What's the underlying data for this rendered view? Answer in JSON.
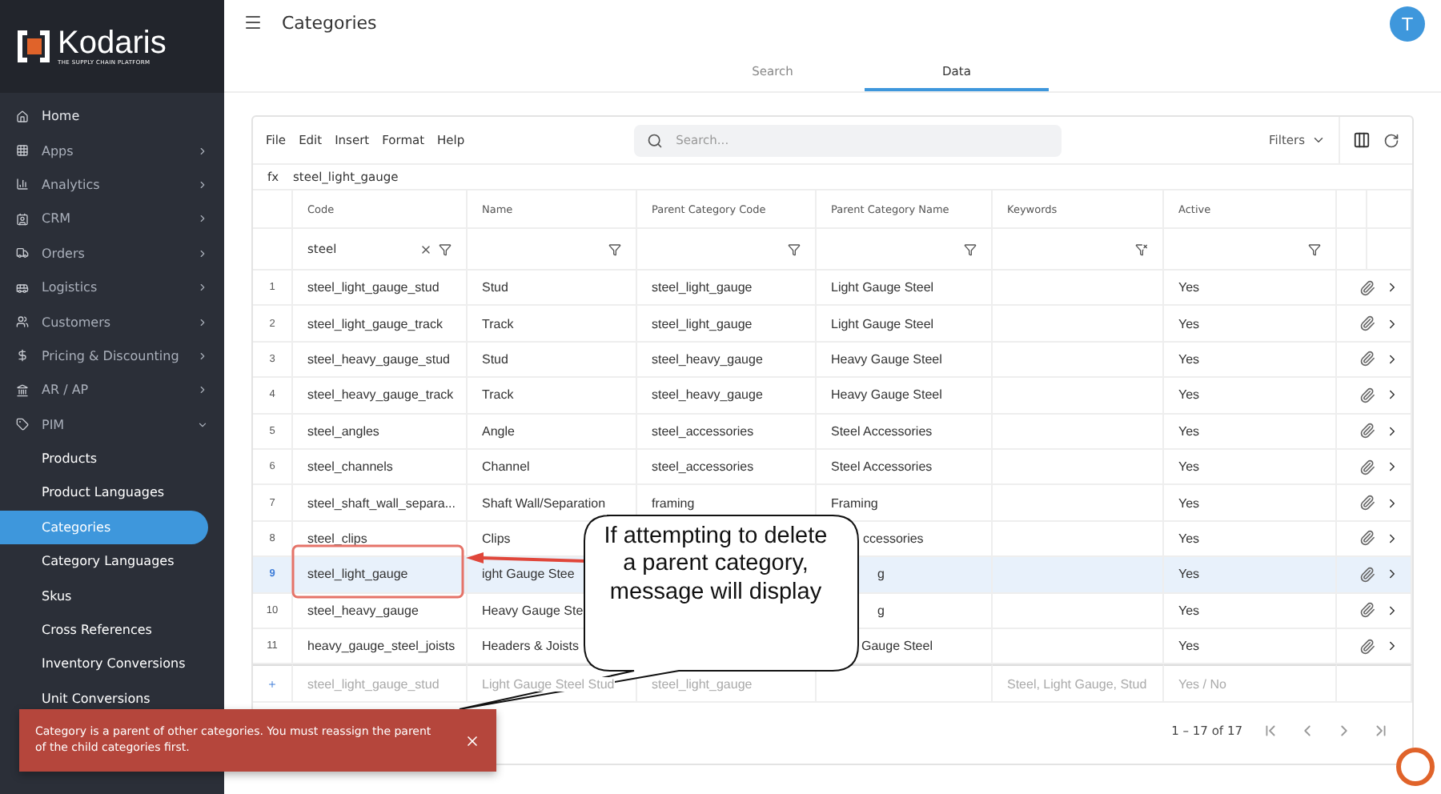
{
  "sidebar": {
    "logo": {
      "name": "Kodaris",
      "tagline": "THE SUPPLY CHAIN PLATFORM"
    },
    "items": [
      {
        "label": "Home",
        "kind": "link"
      },
      {
        "label": "Apps",
        "kind": "group",
        "expanded": false
      },
      {
        "label": "Analytics",
        "kind": "group",
        "expanded": false
      },
      {
        "label": "CRM",
        "kind": "group",
        "expanded": false
      },
      {
        "label": "Orders",
        "kind": "group",
        "expanded": false
      },
      {
        "label": "Logistics",
        "kind": "group",
        "expanded": false
      },
      {
        "label": "Customers",
        "kind": "group",
        "expanded": false
      },
      {
        "label": "Pricing & Discounting",
        "kind": "group",
        "expanded": false
      },
      {
        "label": "AR / AP",
        "kind": "group",
        "expanded": false
      },
      {
        "label": "PIM",
        "kind": "group",
        "expanded": true,
        "children": [
          {
            "label": "Products",
            "selected": false
          },
          {
            "label": "Product Languages",
            "selected": false
          },
          {
            "label": "Categories",
            "selected": true
          },
          {
            "label": "Category Languages",
            "selected": false
          },
          {
            "label": "Skus",
            "selected": false
          },
          {
            "label": "Cross References",
            "selected": false
          },
          {
            "label": "Inventory Conversions",
            "selected": false
          },
          {
            "label": "Unit Conversions",
            "selected": false
          }
        ]
      }
    ]
  },
  "header": {
    "title": "Categories",
    "avatar": "T"
  },
  "tabs": [
    {
      "label": "Search",
      "selected": false
    },
    {
      "label": "Data",
      "selected": true
    }
  ],
  "toolbar": {
    "menu": [
      "File",
      "Edit",
      "Insert",
      "Format",
      "Help"
    ],
    "search": {
      "placeholder": "Search..."
    },
    "filters": "Filters"
  },
  "formula_bar": {
    "label": "fx",
    "value": "steel_light_gauge"
  },
  "table": {
    "columns": [
      {
        "label": "Code",
        "filter": "steel",
        "filter_cleared": false
      },
      {
        "label": "Name",
        "filter_cleared": false
      },
      {
        "label": "Parent Category Code",
        "filter_cleared": false
      },
      {
        "label": "Parent Category Name",
        "filter_cleared": false
      },
      {
        "label": "Keywords",
        "filter_cleared": true
      },
      {
        "label": "Active",
        "filter_cleared": false
      }
    ],
    "rows": [
      {
        "num": "1",
        "code": "steel_light_gauge_stud",
        "name": "Stud",
        "parent_code": "steel_light_gauge",
        "parent_name": "Light Gauge Steel",
        "active": "Yes",
        "selected": false
      },
      {
        "num": "2",
        "code": "steel_light_gauge_track",
        "name": "Track",
        "parent_code": "steel_light_gauge",
        "parent_name": "Light Gauge Steel",
        "active": "Yes",
        "selected": false
      },
      {
        "num": "3",
        "code": "steel_heavy_gauge_stud",
        "name": "Stud",
        "parent_code": "steel_heavy_gauge",
        "parent_name": "Heavy Gauge Steel",
        "active": "Yes",
        "selected": false
      },
      {
        "num": "4",
        "code": "steel_heavy_gauge_track",
        "name": "Track",
        "parent_code": "steel_heavy_gauge",
        "parent_name": "Heavy Gauge Steel",
        "active": "Yes",
        "selected": false
      },
      {
        "num": "5",
        "code": "steel_angles",
        "name": "Angle",
        "parent_code": "steel_accessories",
        "parent_name": "Steel Accessories",
        "active": "Yes",
        "selected": false
      },
      {
        "num": "6",
        "code": "steel_channels",
        "name": "Channel",
        "parent_code": "steel_accessories",
        "parent_name": "Steel Accessories",
        "active": "Yes",
        "selected": false
      },
      {
        "num": "7",
        "code": "steel_shaft_wall_separa...",
        "name": "Shaft Wall/Separation",
        "parent_code": "framing",
        "parent_name": "Framing",
        "active": "Yes",
        "selected": false
      },
      {
        "num": "8",
        "code": "steel_clips",
        "name": "Clips",
        "parent_name": "ccessories",
        "active": "Yes",
        "selected": false
      },
      {
        "num": "9",
        "code": "steel_light_gauge",
        "name": "ight Gauge Stee",
        "parent_name": "g",
        "active": "Yes",
        "selected": true
      },
      {
        "num": "10",
        "code": "steel_heavy_gauge",
        "name": "Heavy Gauge Ste",
        "parent_name": "g",
        "active": "Yes",
        "selected": false
      },
      {
        "num": "11",
        "code": "heavy_gauge_steel_joists",
        "name": "Headers & Joists",
        "parent_name": "Gauge Steel",
        "active": "Yes",
        "selected": false
      }
    ],
    "new_row": {
      "code": "steel_light_gauge_stud",
      "name": "Light Gauge Steel Stud",
      "parent_code": "steel_light_gauge",
      "keywords": "Steel, Light Gauge, Stud",
      "active": "Yes / No"
    }
  },
  "pagination": {
    "range": "1 – 17 of 17"
  },
  "toast": {
    "message": "Category is a parent of other categories. You must reassign the parent of the child categories first."
  },
  "callout": {
    "text": "If attempting to delete a parent category, message will display"
  }
}
